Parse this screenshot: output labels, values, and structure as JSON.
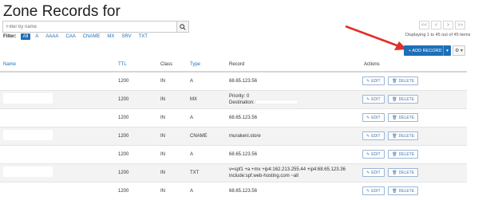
{
  "header": {
    "title": "Zone Records for"
  },
  "search": {
    "placeholder": "Filter by name"
  },
  "filter": {
    "label": "Filter:",
    "options": [
      "All",
      "A",
      "AAAA",
      "CAA",
      "CNAME",
      "MX",
      "SRV",
      "TXT"
    ],
    "active": "All"
  },
  "pager": {
    "first": "<<",
    "prev": "<",
    "next": ">",
    "last": ">>"
  },
  "displaying": "Displaying 1 to 45 out of 45 items",
  "toolbar": {
    "add_label": "+ ADD RECORD",
    "caret": "▾",
    "gear": "⚙ ▾"
  },
  "table": {
    "columns": [
      "Name",
      "TTL",
      "Class",
      "Type",
      "Record",
      "Actions"
    ],
    "rows": [
      {
        "ttl": "1200",
        "class": "IN",
        "type": "A",
        "record": "68.65.123.56"
      },
      {
        "ttl": "1200",
        "class": "IN",
        "type": "MX",
        "priority_label": "Priority:",
        "priority": "0",
        "destination_label": "Destination:"
      },
      {
        "ttl": "1200",
        "class": "IN",
        "type": "A",
        "record": "68.65.123.56"
      },
      {
        "ttl": "1200",
        "class": "IN",
        "type": "CNAME",
        "record": "murakeni.store"
      },
      {
        "ttl": "1200",
        "class": "IN",
        "type": "A",
        "record": "68.65.123.56"
      },
      {
        "ttl": "1200",
        "class": "IN",
        "type": "TXT",
        "record": "v=spf1 +a +mx +ip4:162.213.255.44 +ip4:68.65.123.36 include:spf.web-hosting.com ~all"
      },
      {
        "ttl": "1200",
        "class": "IN",
        "type": "A",
        "record": "68.65.123.56"
      }
    ],
    "edit_label": "EDIT",
    "delete_label": "DELETE"
  },
  "colors": {
    "accent": "#1d6fb8",
    "arrow": "#e0302a"
  }
}
